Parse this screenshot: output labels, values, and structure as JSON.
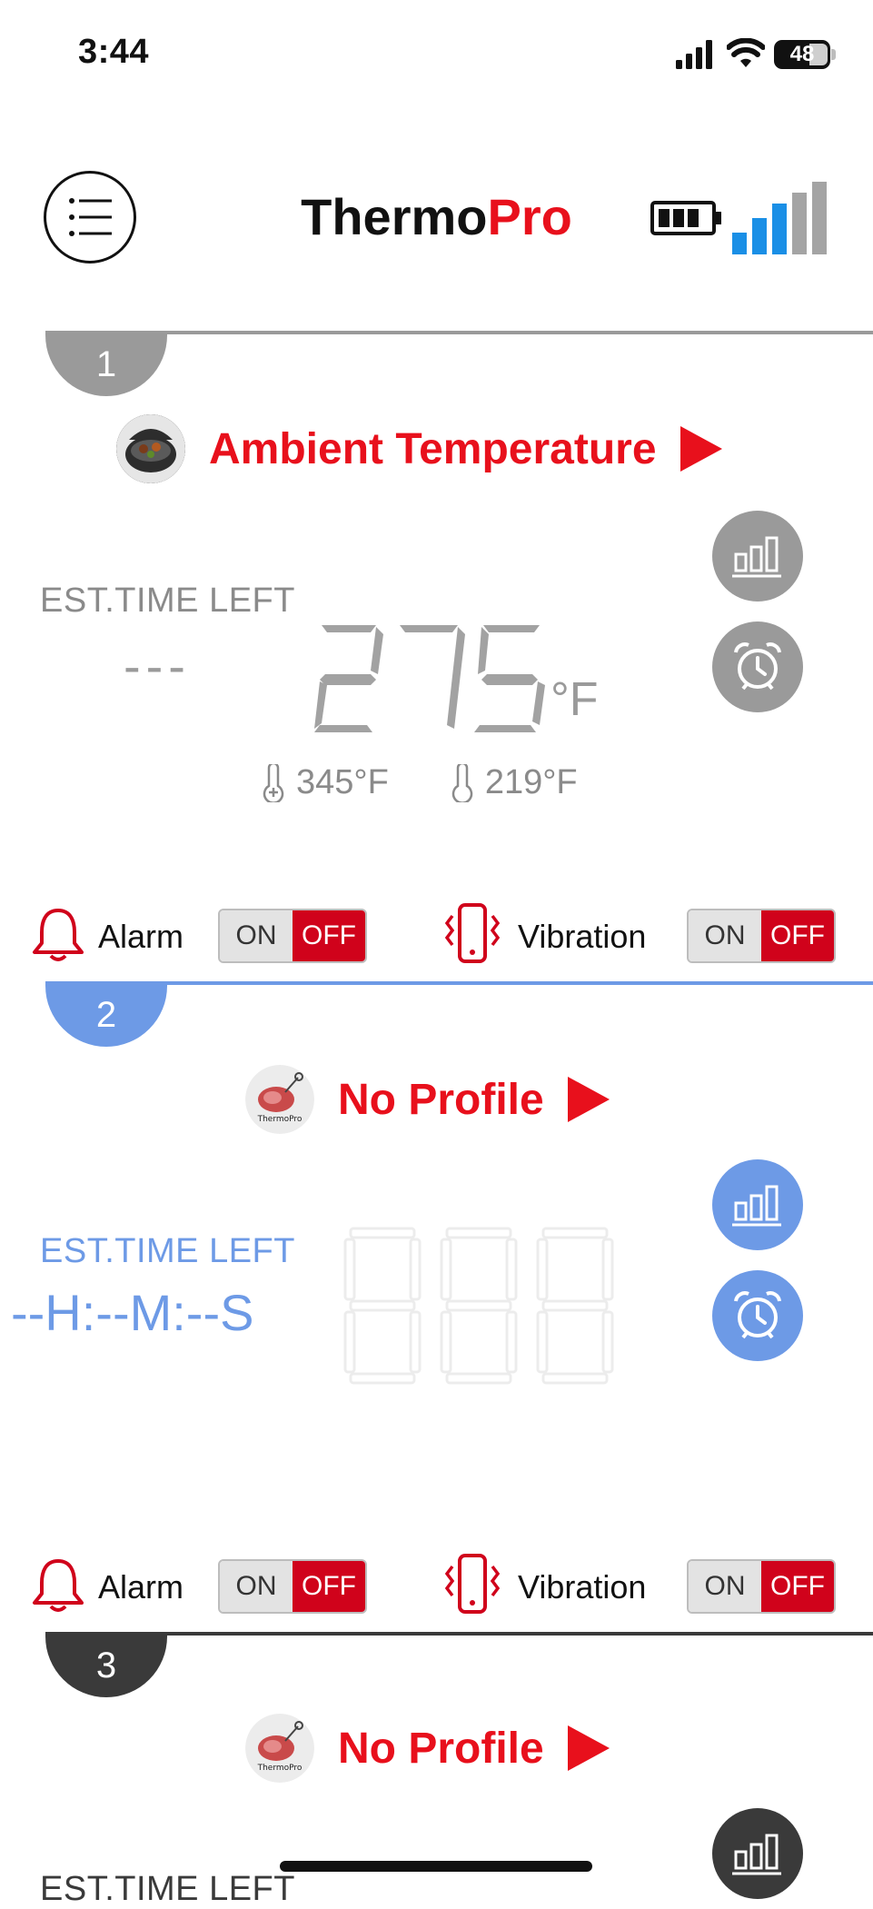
{
  "status_bar": {
    "time": "3:44",
    "battery": "48"
  },
  "header": {
    "title_part1": "Thermo",
    "title_part2": "Pro",
    "menu_icon": "list-menu-icon"
  },
  "colors": {
    "accent_red": "#e8101c",
    "probe1": "#9a9a9a",
    "probe2": "#6d9ae6",
    "probe3": "#3a3a3a"
  },
  "probes": [
    {
      "number": "1",
      "profile": "Ambient Temperature",
      "est_label": "EST.TIME LEFT",
      "est_value": "---",
      "temp": "275",
      "unit": "°F",
      "max_temp": "345°F",
      "min_temp": "219°F",
      "alarm_label": "Alarm",
      "vibration_label": "Vibration",
      "on_label": "ON",
      "off_label": "OFF"
    },
    {
      "number": "2",
      "profile": "No Profile",
      "est_label": "EST.TIME LEFT",
      "est_value": "--H:--M:--S",
      "temp": "888",
      "alarm_label": "Alarm",
      "vibration_label": "Vibration",
      "on_label": "ON",
      "off_label": "OFF"
    },
    {
      "number": "3",
      "profile": "No Profile",
      "est_label": "EST.TIME LEFT"
    }
  ]
}
